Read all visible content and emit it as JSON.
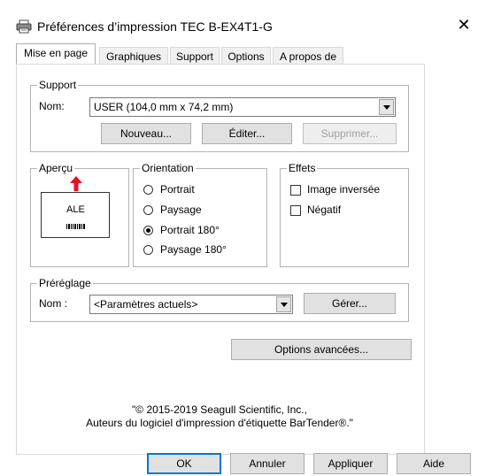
{
  "window": {
    "title": "Préférences d’impression TEC B-EX4T1-G",
    "close_glyph": "✕"
  },
  "tabs": [
    {
      "label": "Mise en page",
      "active": true
    },
    {
      "label": "Graphiques",
      "active": false
    },
    {
      "label": "Support",
      "active": false
    },
    {
      "label": "Options",
      "active": false
    },
    {
      "label": "A propos de",
      "active": false
    }
  ],
  "support": {
    "legend": "Support",
    "name_label": "Nom:",
    "name_value": "USER (104,0 mm x 74,2 mm)",
    "new_button": "Nouveau...",
    "edit_button": "Éditer...",
    "delete_button": "Supprimer..."
  },
  "preview": {
    "legend": "Aperçu",
    "label_text": "ALE"
  },
  "orientation": {
    "legend": "Orientation",
    "options": [
      {
        "label": "Portrait",
        "checked": false
      },
      {
        "label": "Paysage",
        "checked": false
      },
      {
        "label": "Portrait 180°",
        "checked": true
      },
      {
        "label": "Paysage 180°",
        "checked": false
      }
    ]
  },
  "effects": {
    "legend": "Effets",
    "options": [
      {
        "label": "Image inversée",
        "checked": false
      },
      {
        "label": "Négatif",
        "checked": false
      }
    ]
  },
  "preset": {
    "legend": "Préréglage",
    "name_label": "Nom :",
    "name_value": "<Paramètres actuels>",
    "manage_button": "Gérer..."
  },
  "advanced_button": "Options avancées...",
  "copyright": {
    "line1": "\"© 2015-2019 Seagull Scientific, Inc.,",
    "line2": "Auteurs du logiciel d'impression d'étiquette BarTender®.\""
  },
  "footer": {
    "ok": "OK",
    "cancel": "Annuler",
    "apply": "Appliquer",
    "help": "Aide"
  },
  "colors": {
    "accent": "#0078d7",
    "arrow": "#e81123"
  }
}
